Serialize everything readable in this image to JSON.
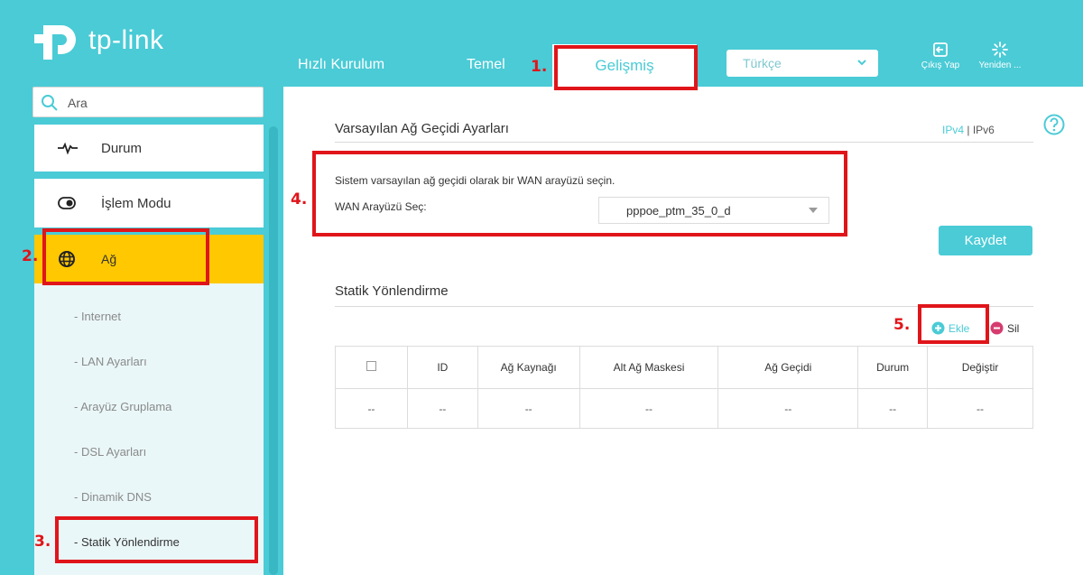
{
  "header": {
    "brand": "tp-link",
    "nav": {
      "quick_setup": "Hızlı Kurulum",
      "basic": "Temel",
      "advanced": "Gelişmiş"
    },
    "language": "Türkçe",
    "logout_label": "Çıkış Yap",
    "reboot_label": "Yeniden ..."
  },
  "sidebar": {
    "search_placeholder": "Ara",
    "items": {
      "status": "Durum",
      "operation_mode": "İşlem Modu",
      "network": "Ağ"
    },
    "submenu": [
      "- Internet",
      "- LAN Ayarları",
      "- Arayüz Gruplama",
      "- DSL Ayarları",
      "- Dinamik DNS",
      "- Statik Yönlendirme"
    ]
  },
  "gateway": {
    "title": "Varsayılan Ağ Geçidi Ayarları",
    "ipv4": "IPv4",
    "separator": "|",
    "ipv6": "IPv6",
    "description": "Sistem varsayılan ağ geçidi olarak bir WAN arayüzü seçin.",
    "wan_label": "WAN Arayüzü Seç:",
    "wan_value": "pppoe_ptm_35_0_d",
    "save_label": "Kaydet"
  },
  "static_routing": {
    "title": "Statik Yönlendirme",
    "add_label": "Ekle",
    "delete_label": "Sil",
    "columns": [
      "ID",
      "Ağ Kaynağı",
      "Alt Ağ Maskesi",
      "Ağ Geçidi",
      "Durum",
      "Değiştir"
    ],
    "row": [
      "--",
      "--",
      "--",
      "--",
      "--",
      "--",
      "--"
    ]
  },
  "annotations": {
    "step1": "1.",
    "step2": "2.",
    "step3": "3.",
    "step4": "4.",
    "step5": "5."
  },
  "colors": {
    "accent": "#4acbd6",
    "active_menu": "#ffc800",
    "annotation": "#e0151a",
    "delete": "#d63b6e"
  }
}
